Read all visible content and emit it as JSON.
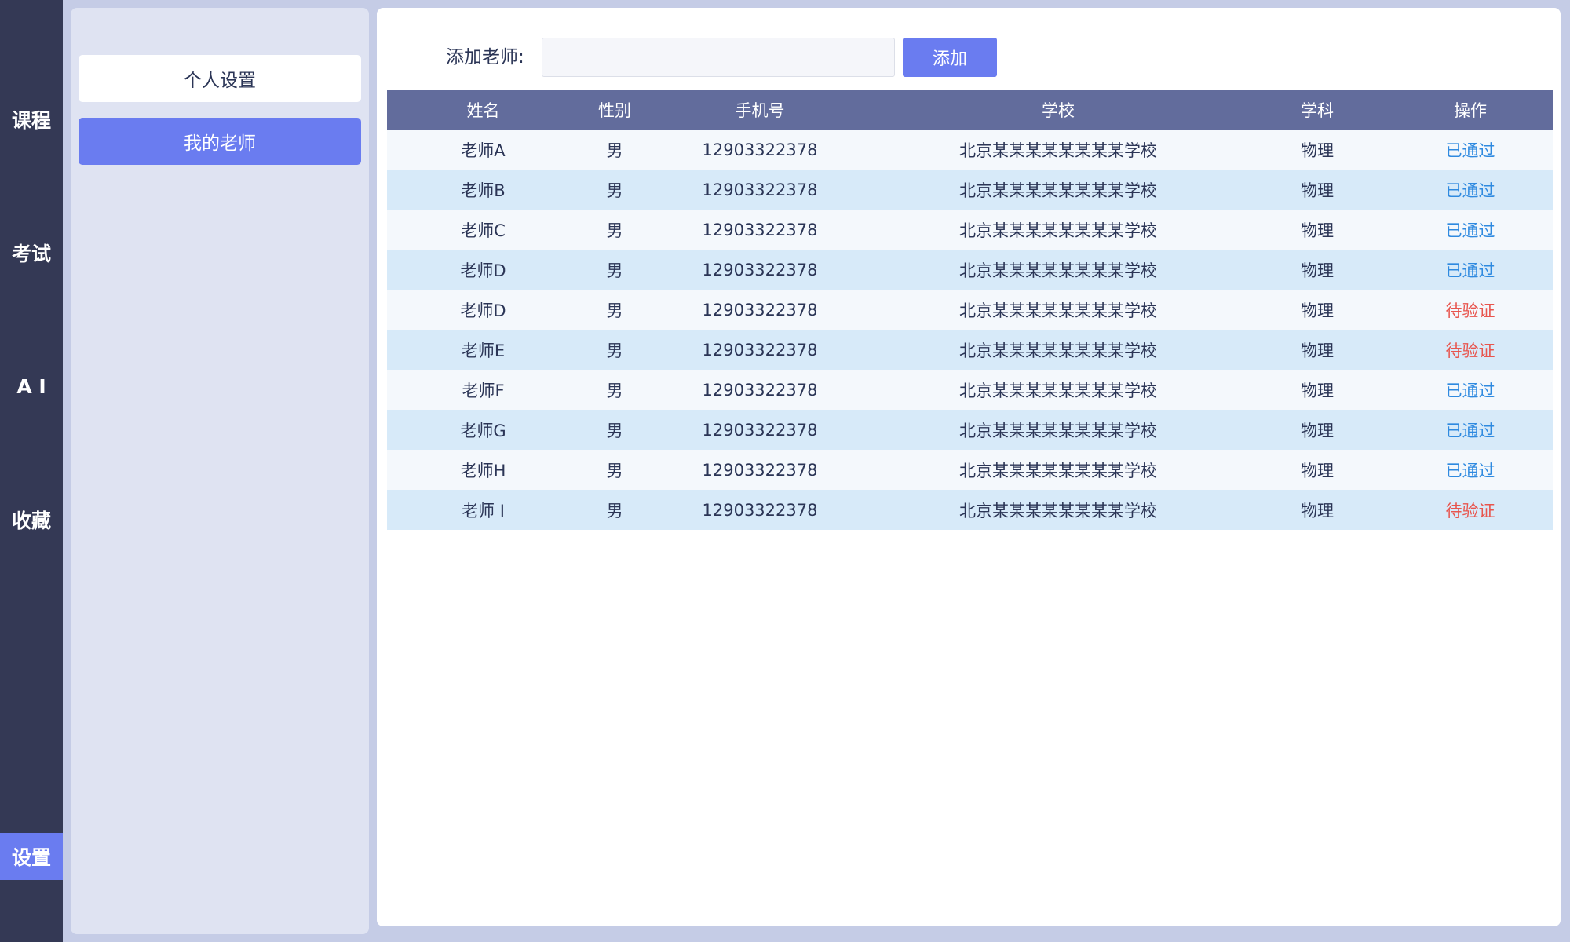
{
  "nav": {
    "items": [
      {
        "label": "课程",
        "active": false
      },
      {
        "label": "考试",
        "active": false
      },
      {
        "label": "A I",
        "active": false
      },
      {
        "label": "收藏",
        "active": false
      },
      {
        "label": "设置",
        "active": true
      }
    ]
  },
  "settings_menu": {
    "items": [
      {
        "label": "个人设置",
        "active": false
      },
      {
        "label": "我的老师",
        "active": true
      }
    ]
  },
  "add_teacher": {
    "label": "添加老师:",
    "input_value": "",
    "button_label": "添加"
  },
  "table": {
    "headers": [
      "姓名",
      "性别",
      "手机号",
      "学校",
      "学科",
      "操作"
    ],
    "rows": [
      {
        "name": "老师A",
        "gender": "男",
        "phone": "12903322378",
        "school": "北京某某某某某某某某学校",
        "subject": "物理",
        "action": "已通过",
        "status": "pass"
      },
      {
        "name": "老师B",
        "gender": "男",
        "phone": "12903322378",
        "school": "北京某某某某某某某某学校",
        "subject": "物理",
        "action": "已通过",
        "status": "pass"
      },
      {
        "name": "老师C",
        "gender": "男",
        "phone": "12903322378",
        "school": "北京某某某某某某某某学校",
        "subject": "物理",
        "action": "已通过",
        "status": "pass"
      },
      {
        "name": "老师D",
        "gender": "男",
        "phone": "12903322378",
        "school": "北京某某某某某某某某学校",
        "subject": "物理",
        "action": "已通过",
        "status": "pass"
      },
      {
        "name": "老师D",
        "gender": "男",
        "phone": "12903322378",
        "school": "北京某某某某某某某某学校",
        "subject": "物理",
        "action": "待验证",
        "status": "pending"
      },
      {
        "name": "老师E",
        "gender": "男",
        "phone": "12903322378",
        "school": "北京某某某某某某某某学校",
        "subject": "物理",
        "action": "待验证",
        "status": "pending"
      },
      {
        "name": "老师F",
        "gender": "男",
        "phone": "12903322378",
        "school": "北京某某某某某某某某学校",
        "subject": "物理",
        "action": "已通过",
        "status": "pass"
      },
      {
        "name": "老师G",
        "gender": "男",
        "phone": "12903322378",
        "school": "北京某某某某某某某某学校",
        "subject": "物理",
        "action": "已通过",
        "status": "pass"
      },
      {
        "name": "老师H",
        "gender": "男",
        "phone": "12903322378",
        "school": "北京某某某某某某某某学校",
        "subject": "物理",
        "action": "已通过",
        "status": "pass"
      },
      {
        "name": "老师 I",
        "gender": "男",
        "phone": "12903322378",
        "school": "北京某某某某某某某某学校",
        "subject": "物理",
        "action": "待验证",
        "status": "pending"
      }
    ]
  }
}
